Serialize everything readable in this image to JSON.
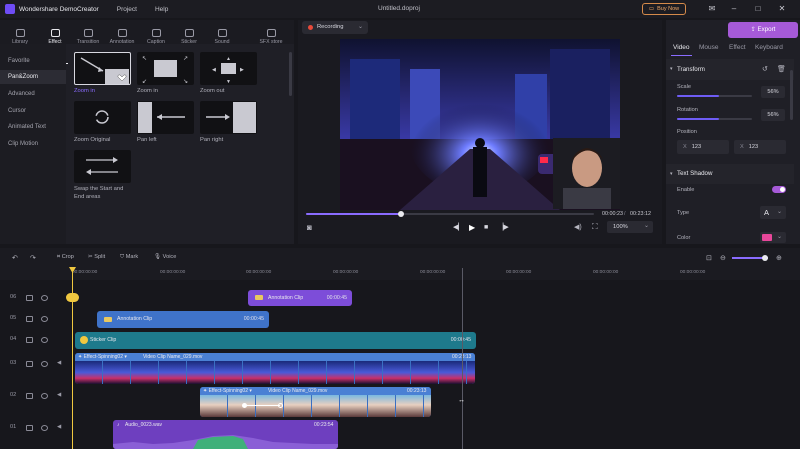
{
  "titlebar": {
    "app_name": "Wondershare DemoCreator",
    "menu": [
      "Project",
      "Help"
    ],
    "document": "Untitled.doproj",
    "buy_now": "Buy Now",
    "window_buttons": [
      "mail-icon",
      "minimize-icon",
      "maximize-icon",
      "close-icon"
    ]
  },
  "left_tabs": [
    {
      "label": "Library",
      "icon": "library-icon"
    },
    {
      "label": "Effect",
      "icon": "effect-icon",
      "active": true
    },
    {
      "label": "Transition",
      "icon": "transition-icon"
    },
    {
      "label": "Annotation",
      "icon": "annotation-icon"
    },
    {
      "label": "Caption",
      "icon": "caption-icon"
    },
    {
      "label": "Sticker",
      "icon": "sticker-icon"
    },
    {
      "label": "Sound",
      "icon": "sound-icon"
    },
    {
      "label": "SFX store",
      "icon": "store-icon"
    }
  ],
  "categories": [
    "Favorite",
    "Pan&Zoom",
    "Advanced",
    "Cursor",
    "Animated Text",
    "Clip Motion"
  ],
  "effects": [
    "Zoom in",
    "Zoom in",
    "Zoom out",
    "Zoom Original",
    "Pan left",
    "Pan right",
    "Swap the Start and End areas"
  ],
  "preview": {
    "recording_label": "Recording",
    "time_current": "00:00:23",
    "time_total": "00:23:12",
    "progress": 0.33,
    "zoom": "100%"
  },
  "right_panel": {
    "tabs": [
      "Video",
      "Mouse",
      "Effect",
      "Keyboard"
    ],
    "export_label": "Export",
    "transform_title": "Transform",
    "scale_label": "Scale",
    "scale_value": "56%",
    "scale_level": 0.56,
    "rotation_label": "Rotation",
    "rotation_value": "56%",
    "rotation_level": 0.56,
    "position_label": "Position",
    "pos_x_label": "X",
    "pos_x": "123",
    "pos_y_label": "X",
    "pos_y": "123",
    "shadow_title": "Text Shadow",
    "enable_label": "Enable",
    "enabled": true,
    "type_label": "Type",
    "type_value": "A",
    "color_label": "Color",
    "color": "#e8479a"
  },
  "timeline": {
    "tools": [
      "Crop",
      "Split",
      "Mark",
      "Voice"
    ],
    "ruler": [
      "00:00:00:00",
      "00:00:00:00",
      "00:00:00:00",
      "00:00:00:00",
      "00:00:00:00",
      "00:00:00:00",
      "00:00:00:00",
      "00:00:00:00"
    ],
    "tracks": [
      "06",
      "05",
      "04",
      "03",
      "02",
      "01"
    ],
    "clips": [
      {
        "name": "Annotation Clip",
        "duration": "00:00:45",
        "color": "#7d4dd9"
      },
      {
        "name": "Annotation Clip",
        "duration": "00:00:45",
        "color": "#3f73c9"
      },
      {
        "name": "Sticker Clip",
        "duration": "00:00:45",
        "color": "#1e7a8c"
      },
      {
        "name": "Video Clip Name_029.mov",
        "effect": "Effect-Spinning02",
        "duration": "00:23:13",
        "color": "#3a6fc2"
      },
      {
        "name": "Video Clip Name_029.mov",
        "effect": "Effect-Spinning02",
        "duration": "00:23:13",
        "color": "#3a6fc2"
      },
      {
        "name": "Audio_0023.wav",
        "duration": "00:23:54",
        "color": "#6e3fbf"
      }
    ]
  },
  "accent": "#6e5cf5"
}
